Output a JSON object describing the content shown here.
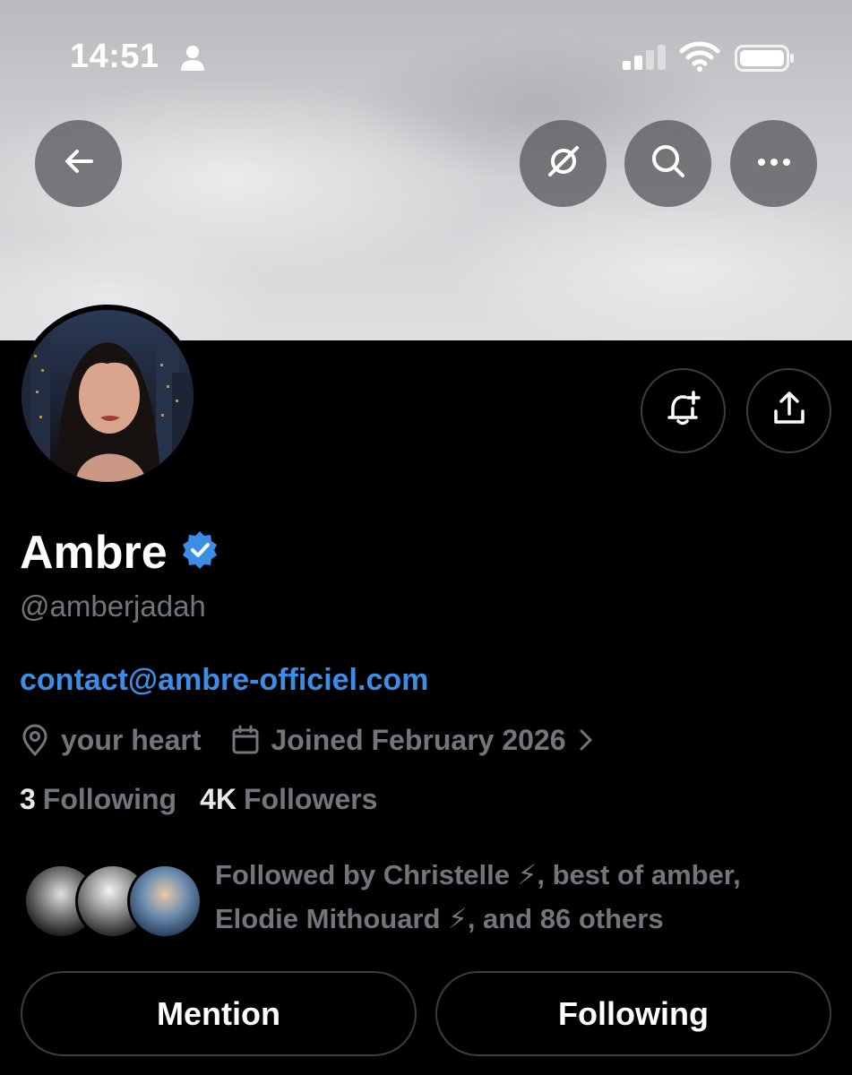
{
  "status_bar": {
    "time": "14:51"
  },
  "profile": {
    "display_name": "Ambre",
    "handle": "@amberjadah",
    "link": "contact@ambre-officiel.com",
    "location": "your heart",
    "joined": "Joined February 2026",
    "following_count": "3",
    "following_label": "Following",
    "followers_count": "4K",
    "followers_label": "Followers",
    "followed_by_line1": "Followed by Christelle ⚡, best of amber,",
    "followed_by_line2": "Elodie Mithouard ⚡, and 86 others"
  },
  "actions": {
    "mention_label": "Mention",
    "following_label": "Following"
  },
  "icons": {
    "back": "back-arrow-icon",
    "grok": "grok-icon",
    "search": "search-icon",
    "more": "more-icon",
    "notify": "notification-bell-plus-icon",
    "share": "share-icon",
    "verified": "verified-badge-icon",
    "location": "location-pin-icon",
    "calendar": "calendar-icon"
  },
  "colors": {
    "background": "#000000",
    "link": "#3b8de6",
    "verified": "#3b8de6",
    "muted_text": "#71767b"
  }
}
